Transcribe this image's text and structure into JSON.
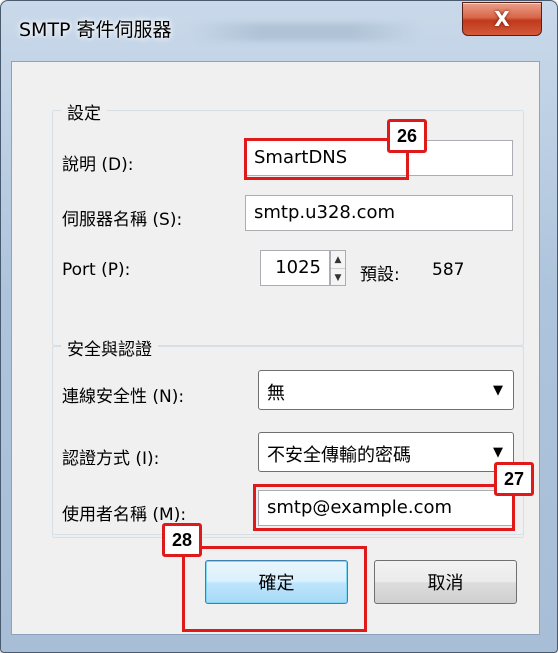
{
  "window": {
    "title": "SMTP 寄件伺服器",
    "close_label": "X"
  },
  "settings": {
    "group_title": "設定",
    "description_label": "說明 (D):",
    "description_value": "SmartDNS",
    "server_label": "伺服器名稱 (S):",
    "server_value": "smtp.u328.com",
    "port_label": "Port (P):",
    "port_value": "1025",
    "default_label": "預設:",
    "default_value": "587"
  },
  "security": {
    "group_title": "安全與認證",
    "connection_label": "連線安全性 (N):",
    "connection_value": "無",
    "auth_label": "認證方式 (I):",
    "auth_value": "不安全傳輸的密碼",
    "username_label": "使用者名稱 (M):",
    "username_value": "smtp@example.com"
  },
  "buttons": {
    "ok": "確定",
    "cancel": "取消"
  },
  "annotations": {
    "badge_26": "26",
    "badge_27": "27",
    "badge_28": "28"
  },
  "icons": {
    "spin_up": "▲",
    "spin_down": "▼",
    "dropdown": "▼"
  },
  "colors": {
    "annotation_red": "#e01a1a",
    "default_button": "#bee6fd",
    "close_button": "#c0391c"
  }
}
